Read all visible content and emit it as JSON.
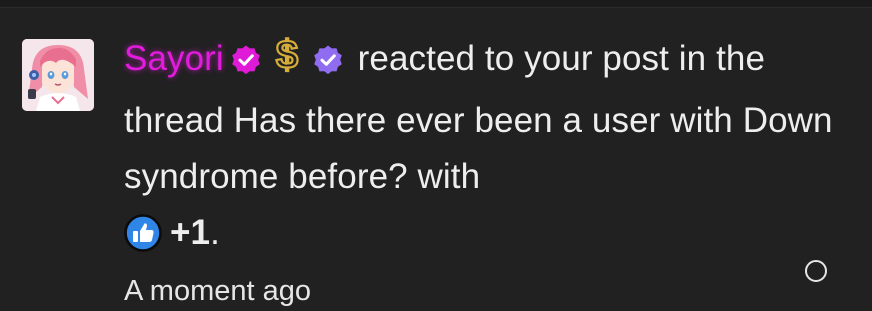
{
  "notification": {
    "username": "Sayori",
    "action_text": "reacted to your post in the thread",
    "thread_title": "Has there ever been a user with Down syndrome before?",
    "with_text": "with",
    "reaction_name": "+1",
    "period": ".",
    "timestamp": "A moment ago",
    "badges": [
      "verified-magenta-icon",
      "dollar-icon",
      "verified-purple-icon"
    ],
    "reaction_icon": "thumbs-up-icon",
    "read_toggle_icon": "circle-outline-icon"
  },
  "colors": {
    "background": "#212121",
    "username": "#e21cdc",
    "badge_magenta": "#e01bd8",
    "badge_purple": "#8f6cf0",
    "dollar_gold": "#d7ad3a",
    "reaction_blue": "#2f86e6",
    "text": "#eeeeee"
  }
}
